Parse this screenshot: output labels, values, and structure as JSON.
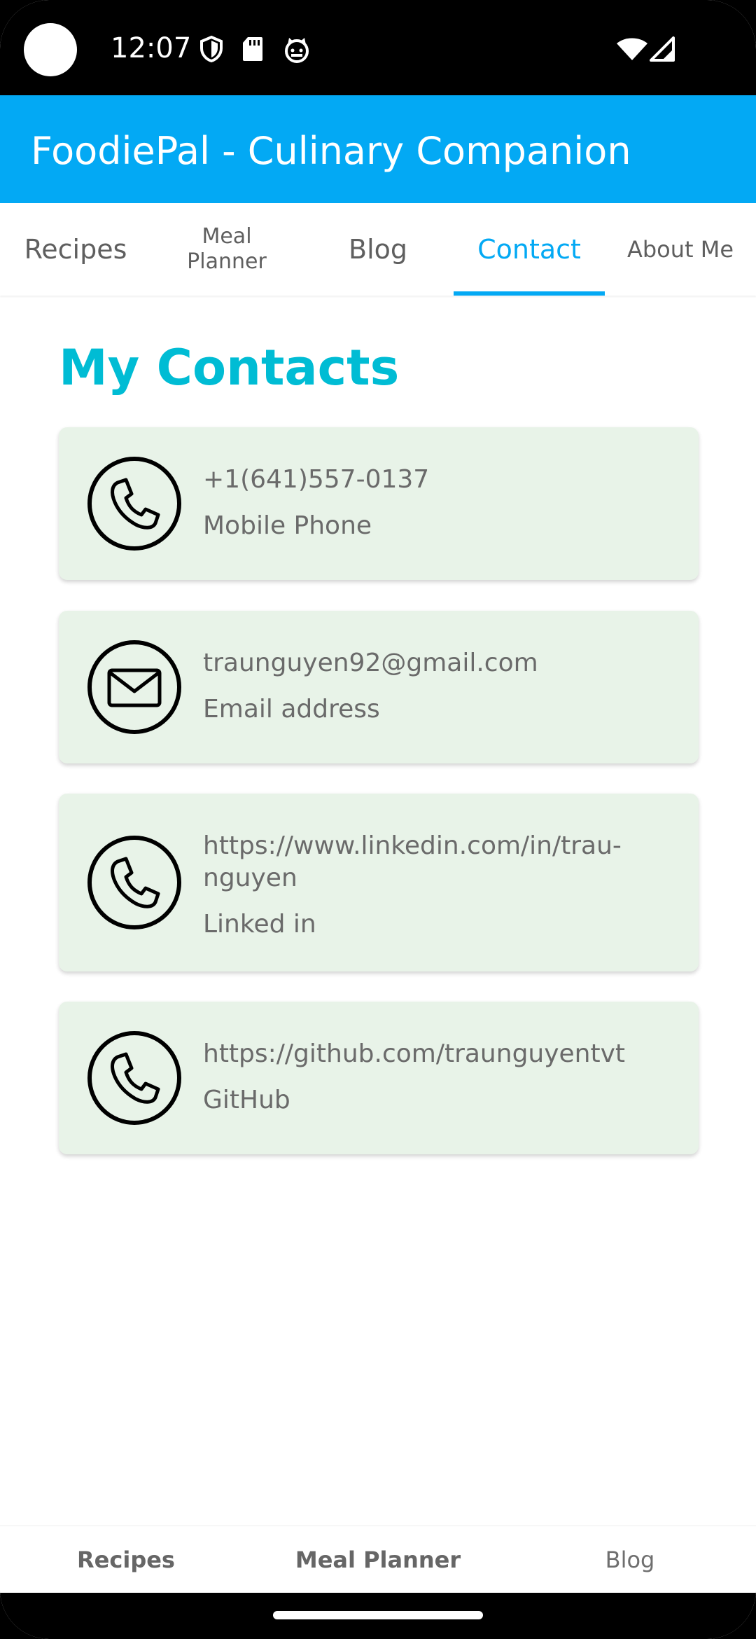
{
  "status_bar": {
    "time": "12:07",
    "icons": [
      "shield-icon",
      "sd-card-icon",
      "cat-icon",
      "wifi-icon",
      "signal-icon"
    ]
  },
  "app_bar": {
    "title": "FoodiePal - Culinary Companion",
    "color": "#03A9F4"
  },
  "top_tabs": {
    "items": [
      {
        "label": "Recipes"
      },
      {
        "label": "Meal Planner"
      },
      {
        "label": "Blog"
      },
      {
        "label": "Contact"
      },
      {
        "label": "About Me"
      }
    ],
    "active": "Contact"
  },
  "content": {
    "heading": "My Contacts",
    "heading_color": "#00BCD4",
    "cards": [
      {
        "icon": "phone-icon",
        "value": "+1(641)557-0137",
        "label": "Mobile Phone"
      },
      {
        "icon": "mail-icon",
        "value": "traunguyen92@gmail.com",
        "label": "Email address"
      },
      {
        "icon": "phone-icon",
        "value": "https://www.linkedin.com/in/trau-nguyen",
        "label": "Linked in"
      },
      {
        "icon": "phone-icon",
        "value": "https://github.com/traunguyentvt",
        "label": "GitHub"
      }
    ],
    "card_color": "#E8F3E8"
  },
  "bottom_nav": {
    "items": [
      {
        "label": "Recipes"
      },
      {
        "label": "Meal Planner"
      },
      {
        "label": "Blog"
      }
    ]
  }
}
